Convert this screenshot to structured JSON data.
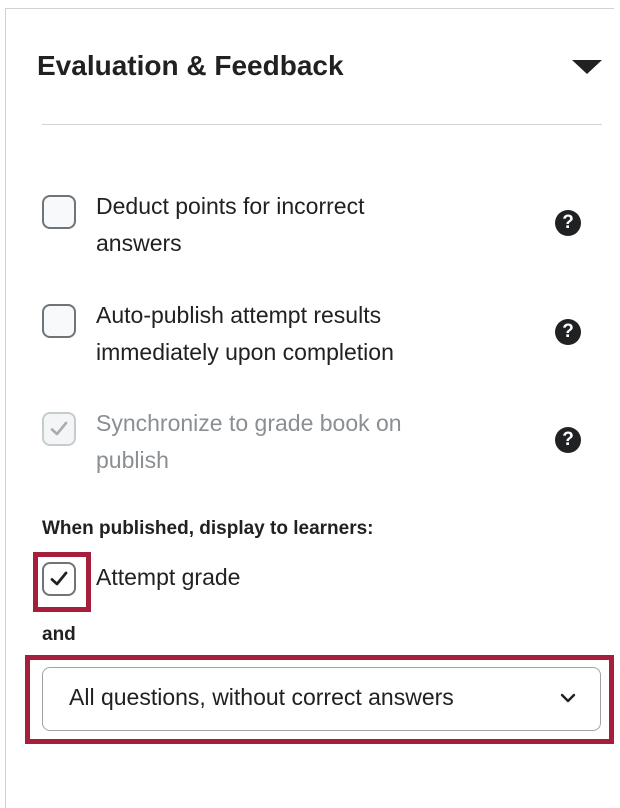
{
  "section": {
    "title": "Evaluation & Feedback",
    "collapse_icon": "caret-down-icon"
  },
  "options": [
    {
      "label_line1": "Deduct points for incorrect",
      "label_line2": "answers",
      "checked": false,
      "disabled": false,
      "help_icon": "help-circle-icon"
    },
    {
      "label_line1": "Auto-publish attempt results",
      "label_line2": "immediately upon completion",
      "checked": false,
      "disabled": false,
      "help_icon": "help-circle-icon"
    },
    {
      "label_line1": "Synchronize to grade book on",
      "label_line2": "publish",
      "checked": true,
      "disabled": true,
      "help_icon": "help-circle-icon"
    }
  ],
  "help_glyph": "?",
  "display": {
    "heading": "When published, display to learners:",
    "attempt_grade_label": "Attempt grade",
    "attempt_grade_checked": true,
    "and_label": "and",
    "questions_select_value": "All questions, without correct answers",
    "questions_select_icon": "chevron-down-icon"
  },
  "colors": {
    "highlight": "#a51e3c",
    "text": "#202122",
    "muted_text": "#8a8f93",
    "divider": "#d3d6d9"
  }
}
